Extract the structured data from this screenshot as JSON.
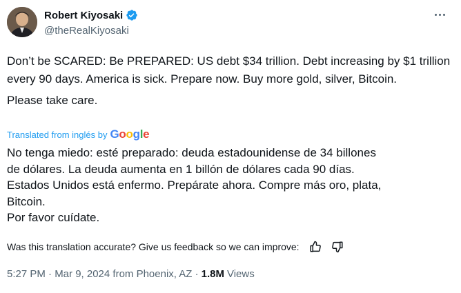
{
  "author": {
    "display_name": "Robert Kiyosaki",
    "handle": "@theRealKiyosaki",
    "verified": true,
    "verified_color": "#1d9bf0"
  },
  "tweet": {
    "paragraph_1": "Don’t be SCARED:  Be PREPARED:  US debt $34 trillion. Debt increasing by $1 trillion every 90 days. America is sick. Prepare now. Buy more gold, silver, Bitcoin.",
    "paragraph_2": "Please take care."
  },
  "translation": {
    "label": "Translated from inglés by",
    "provider": "Google",
    "lines": [
      "No tenga miedo: esté preparado: deuda estadounidense de 34 billones",
      "de dólares. La deuda aumenta en 1 billón de dólares cada 90 días.",
      "Estados Unidos está enfermo. Prepárate ahora. Compre más oro, plata,",
      "Bitcoin.",
      "Por favor cuídate."
    ],
    "feedback_question": "Was this translation accurate? Give us feedback so we can improve:"
  },
  "meta": {
    "time_date": "5:27 PM · Mar 9, 2024 from Phoenix, AZ ·",
    "views_count": "1.8M",
    "views_label": "Views"
  },
  "icons": {
    "more": "more-options-icon",
    "verified": "verified-badge-icon",
    "thumbs_up": "thumbs-up-icon",
    "thumbs_down": "thumbs-down-icon"
  },
  "colors": {
    "text_primary": "#0f1419",
    "text_secondary": "#536471",
    "link_blue": "#1d9bf0"
  }
}
